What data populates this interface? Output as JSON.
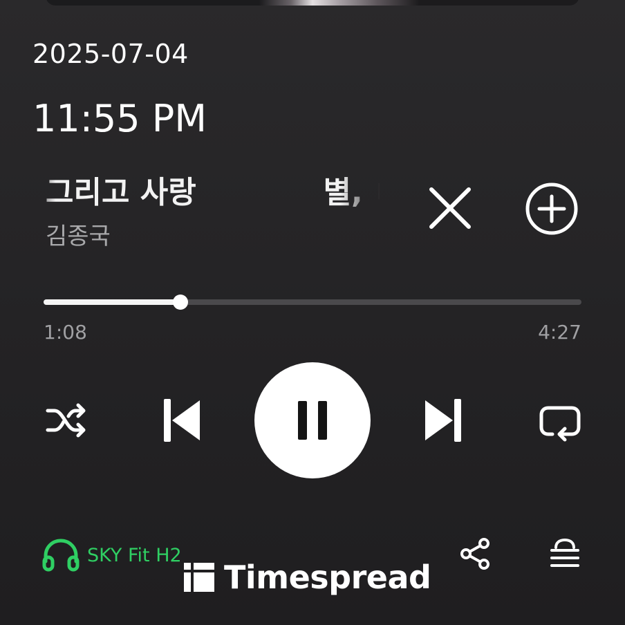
{
  "header": {
    "date": "2025-07-04",
    "time": "11:55 PM"
  },
  "track": {
    "title_marquee": "그리고 사랑            별, ㅂ",
    "artist": "김종국"
  },
  "progress": {
    "elapsed": "1:08",
    "total": "4:27",
    "fraction": 0.255
  },
  "controls": {
    "icons": [
      "shuffle-icon",
      "skip-previous-icon",
      "pause-icon",
      "skip-next-icon",
      "repeat-icon"
    ],
    "close_icon": "close-icon",
    "add_icon": "add-circle-icon"
  },
  "footer": {
    "device_name": "SKY Fit H2",
    "device_icon": "headphones-icon",
    "share_icon": "share-icon",
    "queue_icon": "queue-icon"
  },
  "watermark": {
    "text": "Timespread"
  },
  "colors": {
    "background": "#252426",
    "accent_green": "#2fcf63",
    "text_secondary": "#a0a0a3"
  }
}
